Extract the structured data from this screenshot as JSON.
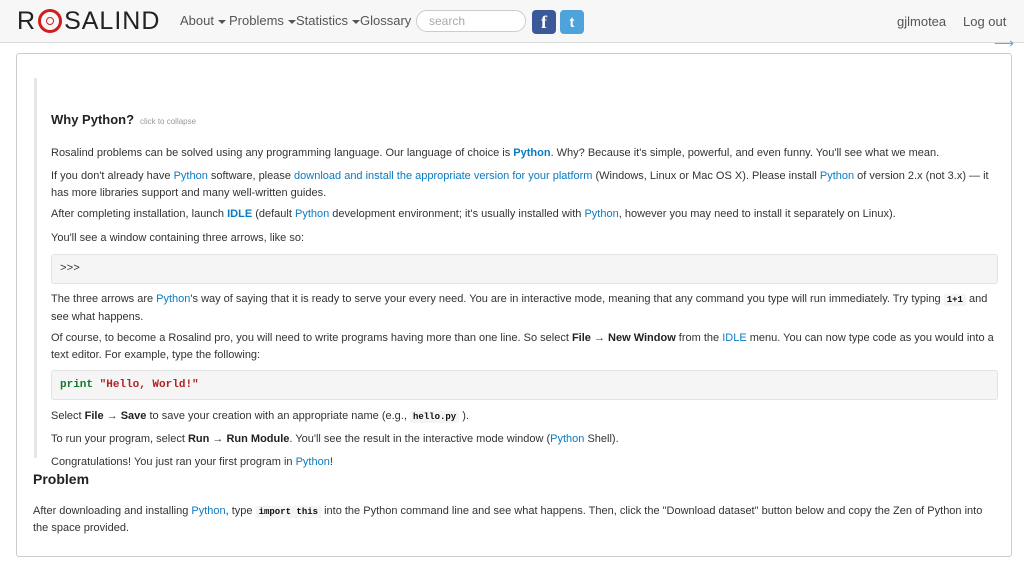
{
  "navbar": {
    "logo_left": "R",
    "logo_right": "SALIND",
    "menu": {
      "about": "About",
      "problems": "Problems",
      "statistics": "Statistics",
      "glossary": "Glossary"
    },
    "search_placeholder": "search",
    "username": "gjlmotea",
    "logout": "Log out",
    "facebook_glyph": "f",
    "twitter_glyph": "t"
  },
  "aside": {
    "title": "Why Python?",
    "collapse_hint": "click to collapse",
    "p1": {
      "a": "Rosalind problems can be solved using any programming language. Our language of choice is ",
      "python": "Python",
      "b": ". Why? Because it's simple, powerful, and even funny. You'll see what we mean."
    },
    "p2": {
      "a": "If you don't already have ",
      "python1": "Python",
      "b": " software, please ",
      "download_link": "download and install the appropriate version for your platform",
      "c": " (Windows, Linux or Mac OS X). Please install ",
      "python2": "Python",
      "d": " of version 2.x (not 3.x) — it has more libraries support and many well-written guides."
    },
    "p3": {
      "a": "After completing installation, launch ",
      "idle": "IDLE",
      "b": " (default ",
      "python1": "Python",
      "c": " development environment; it's usually installed with ",
      "python2": "Python",
      "d": ", however you may need to install it separately on Linux)."
    },
    "p4": "You'll see a window containing three arrows, like so:",
    "prompt_code": ">>>",
    "p5": {
      "a": "The three arrows are ",
      "python": "Python",
      "b": "'s way of saying that it is ready to serve your every need. You are in interactive mode, meaning that any command you type will run immediately. Try typing ",
      "code": "1+1",
      "c": " and see what happens."
    },
    "p6": {
      "a": "Of course, to become a Rosalind pro, you will need to write programs having more than one line. So select ",
      "file": "File",
      "arrow": " → ",
      "new_window": "New Window",
      "b": " from the ",
      "idle": "IDLE",
      "c": " menu. You can now type code as you would into a text editor. For example, type the following:"
    },
    "hello_code": {
      "keyword": "print",
      "string": "\"Hello, World!\""
    },
    "p7": {
      "a": "Select ",
      "file": "File",
      "arrow": " → ",
      "save": "Save",
      "b": " to save your creation with an appropriate name (e.g., ",
      "code": "hello.py",
      "c": " )."
    },
    "p8": {
      "a": "To run your program, select ",
      "run": "Run",
      "arrow": " → ",
      "run_module": "Run Module",
      "b": ". You'll see the result in the interactive mode window (",
      "python": "Python",
      "c": " Shell)."
    },
    "p9": {
      "a": "Congratulations! You just ran your first program in ",
      "python": "Python",
      "b": "!"
    }
  },
  "problem": {
    "title": "Problem",
    "a": "After downloading and installing ",
    "python": "Python",
    "b": ", type ",
    "code": "import this",
    "c": " into the Python command line and see what happens. Then, click the \"Download dataset\" button below and copy the Zen of Python into the space provided."
  }
}
